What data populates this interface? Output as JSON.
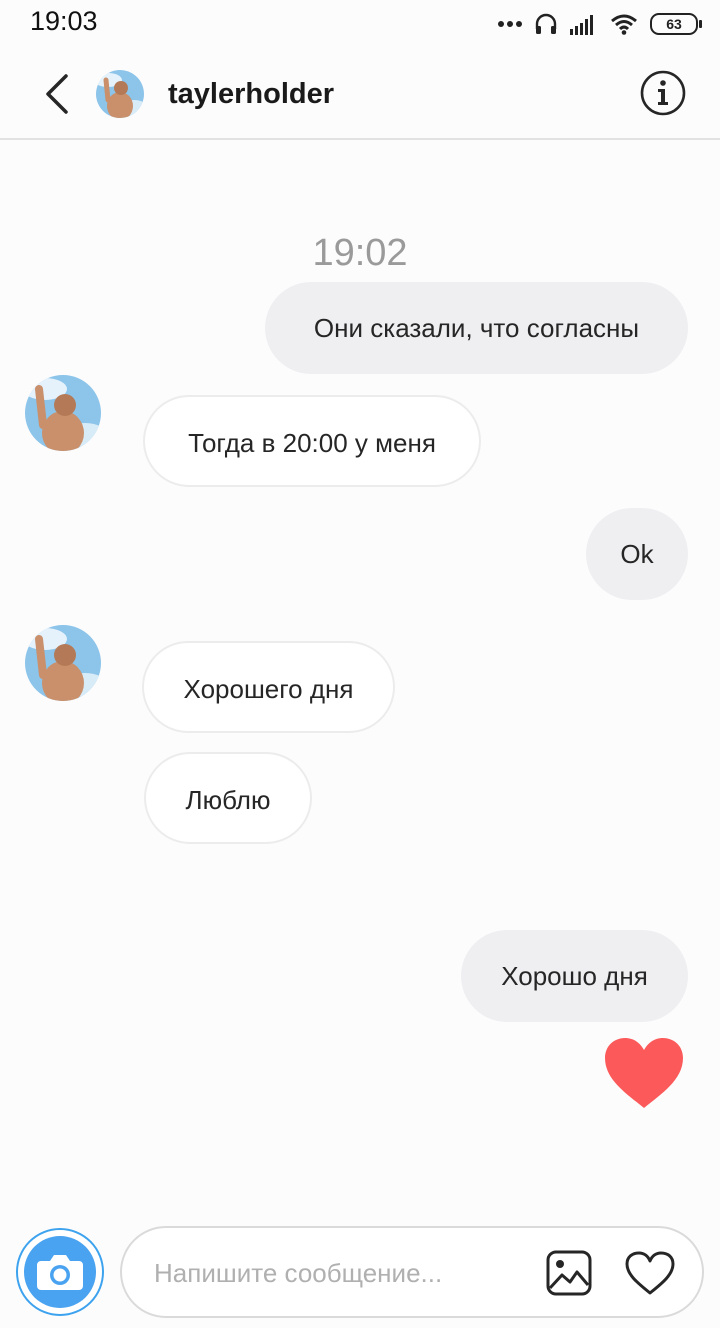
{
  "status_bar": {
    "time": "19:03",
    "battery": "63"
  },
  "header": {
    "username": "taylerholder"
  },
  "chat": {
    "timestamp": "19:02",
    "messages": [
      {
        "direction": "outgoing",
        "text": "Они сказали, что согласны"
      },
      {
        "direction": "incoming",
        "text": "Тогда в 20:00 у меня"
      },
      {
        "direction": "outgoing",
        "text": "Ok"
      },
      {
        "direction": "incoming",
        "text": "Хорошего дня"
      },
      {
        "direction": "incoming",
        "text": "Люблю"
      },
      {
        "direction": "outgoing",
        "text": "Хорошо дня"
      }
    ],
    "reaction": "heart-icon",
    "heart_color": "#fc5a5a"
  },
  "composer": {
    "placeholder": "Напишите сообщение...",
    "camera_color": "#4aa3f0"
  }
}
